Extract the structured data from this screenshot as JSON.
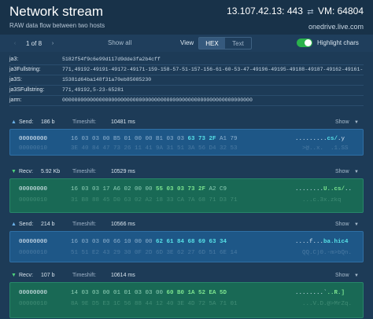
{
  "header": {
    "title": "Network stream",
    "subtitle": "RAW data flow between two hosts",
    "endpoint": "13.107.42.13: 443",
    "swap_glyph": "⇄",
    "vm": "VM: 64804",
    "host": "onedrive.live.com"
  },
  "controls": {
    "prev_glyph": "‹",
    "next_glyph": "›",
    "page": "1 of 8",
    "show_all": "Show all",
    "view_label": "View",
    "view_options": [
      "HEX",
      "Text"
    ],
    "view_selected": "HEX",
    "highlight_label": "Highlight chars",
    "highlight_on": true,
    "toggle_color": "#2bb24c"
  },
  "fingerprints": [
    {
      "key": "ja3:",
      "value": "5182f54f9c6e99d117d9dde3fa2b4cff"
    },
    {
      "key": "ja3Fullstring:",
      "value": "771,49192-49191-49172-49171-159-158-57-51-157-156-61-60-53-47-49196-49195-49188-49187-49162-49161-"
    },
    {
      "key": "ja3S:",
      "value": "15381d64ba148f31a70eb85085230"
    },
    {
      "key": "ja3SFullstring:",
      "value": "771,49192,5-23-65281"
    },
    {
      "key": "jarm:",
      "value": "00000000000000000000000000000000000000000000000000000000000000"
    }
  ],
  "sections": [
    {
      "direction": "send",
      "dir_icon": "▲",
      "label": "Send:",
      "size": "186 b",
      "timeshift_label": "Timeshift:",
      "timeshift": "10481 ms",
      "show_label": "Show",
      "show_caret": "▼",
      "main": {
        "offset": "00000000",
        "bytes_pre": "16 03 03 00 B5 01 00 00 B1 03 03 ",
        "bytes_hl": "63 73 2F",
        "bytes_post": " A1 79",
        "ascii_pre": ".........",
        "ascii_hl": "cs/",
        "ascii_post": ".y"
      },
      "ghost": {
        "offset": "00000010",
        "bytes": "3E 40 84 47 73 26 11 41 9A 31 51 3A 56 D4 32 53",
        "ascii": "  >@..x.  .1.SS"
      }
    },
    {
      "direction": "recv",
      "dir_icon": "▼",
      "label": "Recv:",
      "size": "5.92 Kb",
      "timeshift_label": "Timeshift:",
      "timeshift": "10529 ms",
      "show_label": "Show",
      "show_caret": "▼",
      "main": {
        "offset": "00000000",
        "bytes_pre": "16 03 03 17 A6 02 00 00 ",
        "bytes_hl": "55 03 03 73 2F",
        "bytes_post": " A2 C9",
        "ascii_pre": "........",
        "ascii_hl": "U..cs/",
        "ascii_post": ".."
      },
      "ghost": {
        "offset": "00000010",
        "bytes": "31 B8 88 45 D0 63 02 A2 18 33 CA 7A 68 71 D3 71",
        "ascii": "  ...c.3x.zkq"
      }
    },
    {
      "direction": "send",
      "dir_icon": "▲",
      "label": "Send:",
      "size": "214 b",
      "timeshift_label": "Timeshift:",
      "timeshift": "10566 ms",
      "show_label": "Show",
      "show_caret": "▼",
      "main": {
        "offset": "00000000",
        "bytes_pre": "16 03 03 00 66 10 00 00 ",
        "bytes_hl": "62 61 84 68 69 63 34",
        "bytes_post": "",
        "ascii_pre": "....f...",
        "ascii_hl": "ba.hic4",
        "ascii_post": ""
      },
      "ghost": {
        "offset": "00000010",
        "bytes": "51 51 E2 43 29 30 0F 2D 6D 3E 62 27 6D 51 6E 14",
        "ascii": "  QQ.C)0.-m>bQn."
      }
    },
    {
      "direction": "recv",
      "dir_icon": "▼",
      "label": "Recv:",
      "size": "107 b",
      "timeshift_label": "Timeshift:",
      "timeshift": "10614 ms",
      "show_label": "Show",
      "show_caret": "▼",
      "main": {
        "offset": "00000000",
        "bytes_pre": "14 03 03 00 01 01 03 03 00 ",
        "bytes_hl": "60 B0 1A 52 EA 5D",
        "bytes_post": "",
        "ascii_pre": "........`",
        "ascii_hl": "..R.]",
        "ascii_post": ""
      },
      "ghost": {
        "offset": "00000010",
        "bytes": "8A 9E D5 E3 1C 56 88 44 12 40 3E 4D 72 5A 71 01",
        "ascii": "  ...V.D.@>MrZq."
      }
    }
  ]
}
